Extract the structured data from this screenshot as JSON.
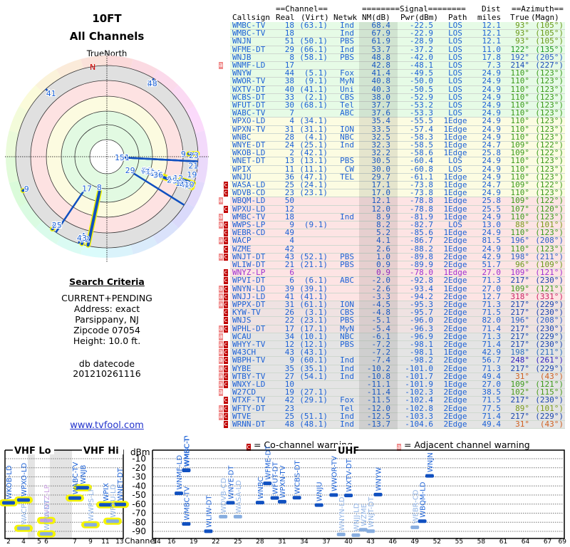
{
  "report": {
    "title": "10FT",
    "subtitle": "All Channels",
    "north_label": "TrueNorth",
    "n_marker": "N"
  },
  "criteria": {
    "heading": "Search Criteria",
    "lines": [
      "CURRENT+PENDING",
      "Address: exact",
      "Parsippany, NJ",
      "Zipcode 07054",
      "Height: 10.0 ft."
    ],
    "datecode_label": "db datecode",
    "datecode": "201210261116",
    "link": "www.tvfool.com"
  },
  "table": {
    "group_headers": {
      "channel": "==Channel==",
      "signal": "========Signal========",
      "dist": "Dist",
      "azimuth": "==Azimuth=="
    },
    "columns": [
      "Callsign",
      "Real",
      "(Virt)",
      "Netwk",
      "NM(dB)",
      "Pwr(dBm)",
      "Path",
      "miles",
      "True",
      "(Magn)"
    ],
    "rows": [
      {
        "flags": "",
        "call": "WMBC-TV",
        "real": "18",
        "virt": "(63.1)",
        "net": "Ind",
        "nm": "68.4",
        "pwr": "-22.5",
        "path": "LOS",
        "dist": "12.1",
        "true": "93°",
        "magn": "(105°)",
        "az_color": "#6a9a1a",
        "bg": "green"
      },
      {
        "flags": "",
        "call": "WMBC-TV",
        "real": "18",
        "virt": "",
        "net": "Ind",
        "nm": "67.9",
        "pwr": "-22.9",
        "path": "LOS",
        "dist": "12.1",
        "true": "93°",
        "magn": "(105°)",
        "az_color": "#6a9a1a",
        "bg": "green"
      },
      {
        "flags": "",
        "call": "WNJN",
        "real": "51",
        "virt": "(50.1)",
        "net": "PBS",
        "nm": "61.9",
        "pwr": "-28.9",
        "path": "LOS",
        "dist": "12.1",
        "true": "93°",
        "magn": "(105°)",
        "az_color": "#6a9a1a",
        "bg": "green"
      },
      {
        "flags": "",
        "call": "WFME-DT",
        "real": "29",
        "virt": "(66.1)",
        "net": "Ind",
        "nm": "53.7",
        "pwr": "-37.2",
        "path": "LOS",
        "dist": "11.0",
        "true": "122°",
        "magn": "(135°)",
        "az_color": "#229a22",
        "bg": "green"
      },
      {
        "flags": "",
        "call": "WNJB",
        "real": "8",
        "virt": "(58.1)",
        "net": "PBS",
        "nm": "48.8",
        "pwr": "-42.0",
        "path": "LOS",
        "dist": "17.8",
        "true": "192°",
        "magn": "(205°)",
        "az_color": "#2a5fc8",
        "bg": "green"
      },
      {
        "flags": "a",
        "call": "WNMF-LD",
        "real": "17",
        "virt": "",
        "net": "",
        "nm": "42.8",
        "pwr": "-48.1",
        "path": "LOS",
        "dist": "7.3",
        "true": "214°",
        "magn": "(227°)",
        "az_color": "#1a4cb8",
        "bg": "green"
      },
      {
        "flags": "",
        "call": "WNYW",
        "real": "44",
        "virt": "(5.1)",
        "net": "Fox",
        "nm": "41.4",
        "pwr": "-49.5",
        "path": "LOS",
        "dist": "24.9",
        "true": "110°",
        "magn": "(123°)",
        "az_color": "#3a9a1a",
        "bg": "green"
      },
      {
        "flags": "",
        "call": "WWOR-TV",
        "real": "38",
        "virt": "(9.1)",
        "net": "MyN",
        "nm": "40.8",
        "pwr": "-50.0",
        "path": "LOS",
        "dist": "24.9",
        "true": "110°",
        "magn": "(123°)",
        "az_color": "#3a9a1a",
        "bg": "green"
      },
      {
        "flags": "",
        "call": "WXTV-DT",
        "real": "40",
        "virt": "(41.1)",
        "net": "Uni",
        "nm": "40.3",
        "pwr": "-50.5",
        "path": "LOS",
        "dist": "24.9",
        "true": "110°",
        "magn": "(123°)",
        "az_color": "#3a9a1a",
        "bg": "green"
      },
      {
        "flags": "",
        "call": "WCBS-DT",
        "real": "33",
        "virt": "(2.1)",
        "net": "CBS",
        "nm": "38.0",
        "pwr": "-52.9",
        "path": "LOS",
        "dist": "24.9",
        "true": "110°",
        "magn": "(123°)",
        "az_color": "#3a9a1a",
        "bg": "green"
      },
      {
        "flags": "",
        "call": "WFUT-DT",
        "real": "30",
        "virt": "(68.1)",
        "net": "Tel",
        "nm": "37.7",
        "pwr": "-53.2",
        "path": "LOS",
        "dist": "24.9",
        "true": "110°",
        "magn": "(123°)",
        "az_color": "#3a9a1a",
        "bg": "green"
      },
      {
        "flags": "",
        "call": "WABC-TV",
        "real": "7",
        "virt": "",
        "net": "ABC",
        "nm": "37.6",
        "pwr": "-53.3",
        "path": "LOS",
        "dist": "24.9",
        "true": "110°",
        "magn": "(123°)",
        "az_color": "#3a9a1a",
        "bg": "green"
      },
      {
        "flags": "",
        "call": "WPXO-LD",
        "real": "4",
        "virt": "(34.1)",
        "net": "",
        "nm": "35.4",
        "pwr": "-55.5",
        "path": "1Edge",
        "dist": "24.9",
        "true": "110°",
        "magn": "(123°)",
        "az_color": "#3a9a1a",
        "bg": "yellow"
      },
      {
        "flags": "",
        "call": "WPXN-TV",
        "real": "31",
        "virt": "(31.1)",
        "net": "ION",
        "nm": "33.5",
        "pwr": "-57.4",
        "path": "1Edge",
        "dist": "24.9",
        "true": "110°",
        "magn": "(123°)",
        "az_color": "#3a9a1a",
        "bg": "yellow"
      },
      {
        "flags": "",
        "call": "WNBC",
        "real": "28",
        "virt": "(4.1)",
        "net": "NBC",
        "nm": "32.5",
        "pwr": "-58.3",
        "path": "1Edge",
        "dist": "24.9",
        "true": "110°",
        "magn": "(123°)",
        "az_color": "#3a9a1a",
        "bg": "yellow"
      },
      {
        "flags": "",
        "call": "WNYE-DT",
        "real": "24",
        "virt": "(25.1)",
        "net": "Ind",
        "nm": "32.3",
        "pwr": "-58.5",
        "path": "1Edge",
        "dist": "24.7",
        "true": "109°",
        "magn": "(122°)",
        "az_color": "#3a9a1a",
        "bg": "yellow"
      },
      {
        "flags": "",
        "call": "WKOB-LD",
        "real": "2",
        "virt": "(42.1)",
        "net": "",
        "nm": "32.2",
        "pwr": "-58.6",
        "path": "1Edge",
        "dist": "25.8",
        "true": "109°",
        "magn": "(122°)",
        "az_color": "#3a9a1a",
        "bg": "yellow"
      },
      {
        "flags": "",
        "call": "WNET-DT",
        "real": "13",
        "virt": "(13.1)",
        "net": "PBS",
        "nm": "30.5",
        "pwr": "-60.4",
        "path": "LOS",
        "dist": "24.9",
        "true": "110°",
        "magn": "(123°)",
        "az_color": "#3a9a1a",
        "bg": "yellow"
      },
      {
        "flags": "",
        "call": "WPIX",
        "real": "11",
        "virt": "(11.1)",
        "net": "CW",
        "nm": "30.0",
        "pwr": "-60.8",
        "path": "LOS",
        "dist": "24.9",
        "true": "110°",
        "magn": "(123°)",
        "az_color": "#3a9a1a",
        "bg": "yellow"
      },
      {
        "flags": "",
        "call": "WNJU",
        "real": "36",
        "virt": "(47.1)",
        "net": "TEL",
        "nm": "29.7",
        "pwr": "-61.1",
        "path": "1Edge",
        "dist": "24.9",
        "true": "110°",
        "magn": "(123°)",
        "az_color": "#3a9a1a",
        "bg": "yellow"
      },
      {
        "flags": "c",
        "call": "WASA-LD",
        "real": "25",
        "virt": "(24.1)",
        "net": "",
        "nm": "17.1",
        "pwr": "-73.8",
        "path": "1Edge",
        "dist": "24.7",
        "true": "109°",
        "magn": "(122°)",
        "az_color": "#3a9a1a",
        "bg": "yellow"
      },
      {
        "flags": "c",
        "call": "WDVB-CD",
        "real": "23",
        "virt": "(23.1)",
        "net": "",
        "nm": "17.0",
        "pwr": "-73.8",
        "path": "1Edge",
        "dist": "24.9",
        "true": "110°",
        "magn": "(123°)",
        "az_color": "#3a9a1a",
        "bg": "yellow"
      },
      {
        "flags": "a",
        "call": "WBQM-LD",
        "real": "50",
        "virt": "",
        "net": "",
        "nm": "12.1",
        "pwr": "-78.8",
        "path": "1Edge",
        "dist": "25.8",
        "true": "109°",
        "magn": "(122°)",
        "az_color": "#3a9a1a",
        "bg": "pink"
      },
      {
        "flags": "c",
        "call": "WPXU-LD",
        "real": "12",
        "virt": "",
        "net": "",
        "nm": "12.0",
        "pwr": "-78.8",
        "path": "1Edge",
        "dist": "25.5",
        "true": "107°",
        "magn": "(120°)",
        "az_color": "#3a9a1a",
        "bg": "pink"
      },
      {
        "flags": "a",
        "call": "WMBC-TV",
        "real": "18",
        "virt": "",
        "net": "Ind",
        "nm": "8.9",
        "pwr": "-81.9",
        "path": "1Edge",
        "dist": "24.9",
        "true": "110°",
        "magn": "(123°)",
        "az_color": "#3a9a1a",
        "bg": "pink"
      },
      {
        "flags": "ac",
        "call": "WWPS-LP",
        "real": "9",
        "virt": "(9.1)",
        "net": "",
        "nm": "8.2",
        "pwr": "-82.7",
        "path": "LOS",
        "dist": "13.0",
        "true": "88°",
        "magn": "(101°)",
        "az_color": "#7a9a1a",
        "bg": "pink"
      },
      {
        "flags": "c",
        "call": "WEBR-CD",
        "real": "49",
        "virt": "",
        "net": "",
        "nm": "5.2",
        "pwr": "-85.6",
        "path": "1Edge",
        "dist": "24.9",
        "true": "110°",
        "magn": "(123°)",
        "az_color": "#3a9a1a",
        "bg": "pink"
      },
      {
        "flags": "ac",
        "call": "WACP",
        "real": "4",
        "virt": "",
        "net": "",
        "nm": "4.1",
        "pwr": "-86.7",
        "path": "2Edge",
        "dist": "81.5",
        "true": "196°",
        "magn": "(208°)",
        "az_color": "#2a5fc8",
        "bg": "pink"
      },
      {
        "flags": "c",
        "call": "WZME",
        "real": "42",
        "virt": "",
        "net": "",
        "nm": "2.6",
        "pwr": "-88.2",
        "path": "1Edge",
        "dist": "24.9",
        "true": "110°",
        "magn": "(123°)",
        "az_color": "#3a9a1a",
        "bg": "pink"
      },
      {
        "flags": "ac",
        "call": "WNJT-DT",
        "real": "43",
        "virt": "(52.1)",
        "net": "PBS",
        "nm": "1.0",
        "pwr": "-89.8",
        "path": "2Edge",
        "dist": "42.9",
        "true": "198°",
        "magn": "(211°)",
        "az_color": "#2a5fc8",
        "bg": "pink"
      },
      {
        "flags": "",
        "call": "WLIW-DT",
        "real": "21",
        "virt": "(21.1)",
        "net": "PBS",
        "nm": "0.9",
        "pwr": "-89.9",
        "path": "2Edge",
        "dist": "51.7",
        "true": "96°",
        "magn": "(109°)",
        "az_color": "#6a9a1a",
        "bg": "pink"
      },
      {
        "flags": "c",
        "call": "WNYZ-LP",
        "real": "6",
        "virt": "",
        "net": "",
        "nm": "0.9",
        "pwr": "-78.0",
        "path": "1Edge",
        "dist": "27.0",
        "true": "109°",
        "magn": "(121°)",
        "az_color": "#3a9a1a",
        "bg": "pink",
        "text_color": "#a030d0"
      },
      {
        "flags": "c",
        "call": "WPVI-DT",
        "real": "6",
        "virt": "(6.1)",
        "net": "ABC",
        "nm": "-2.0",
        "pwr": "-92.8",
        "path": "2Edge",
        "dist": "71.3",
        "true": "217°",
        "magn": "(230°)",
        "az_color": "#1a45b0",
        "bg": "pink"
      },
      {
        "flags": "ac",
        "call": "WNYN-LD",
        "real": "39",
        "virt": "(39.1)",
        "net": "",
        "nm": "-2.6",
        "pwr": "-93.4",
        "path": "1Edge",
        "dist": "27.0",
        "true": "109°",
        "magn": "(121°)",
        "az_color": "#3a9a1a",
        "bg": "pink"
      },
      {
        "flags": "ac",
        "call": "WNJJ-LD",
        "real": "41",
        "virt": "(41.1)",
        "net": "",
        "nm": "-3.3",
        "pwr": "-94.2",
        "path": "2Edge",
        "dist": "12.7",
        "true": "318°",
        "magn": "(331°)",
        "az_color": "#cc2266",
        "bg": "pink"
      },
      {
        "flags": "ac",
        "call": "WPPX-DT",
        "real": "31",
        "virt": "(61.1)",
        "net": "ION",
        "nm": "-4.5",
        "pwr": "-95.3",
        "path": "2Edge",
        "dist": "71.3",
        "true": "217°",
        "magn": "(229°)",
        "az_color": "#1a45b0",
        "bg": "pinkgray"
      },
      {
        "flags": "c",
        "call": "KYW-TV",
        "real": "26",
        "virt": "(3.1)",
        "net": "CBS",
        "nm": "-4.8",
        "pwr": "-95.7",
        "path": "2Edge",
        "dist": "71.5",
        "true": "217°",
        "magn": "(230°)",
        "az_color": "#1a45b0",
        "bg": "pinkgray"
      },
      {
        "flags": "c",
        "call": "WNJS",
        "real": "22",
        "virt": "(23.1)",
        "net": "PBS",
        "nm": "-5.1",
        "pwr": "-96.0",
        "path": "2Edge",
        "dist": "82.0",
        "true": "196°",
        "magn": "(208°)",
        "az_color": "#2a5fc8",
        "bg": "pinkgray"
      },
      {
        "flags": "ac",
        "call": "WPHL-DT",
        "real": "17",
        "virt": "(17.1)",
        "net": "MyN",
        "nm": "-5.4",
        "pwr": "-96.3",
        "path": "2Edge",
        "dist": "71.4",
        "true": "217°",
        "magn": "(230°)",
        "az_color": "#1a45b0",
        "bg": "pinkgray"
      },
      {
        "flags": "a",
        "call": "WCAU",
        "real": "34",
        "virt": "(10.1)",
        "net": "NBC",
        "nm": "-6.1",
        "pwr": "-96.9",
        "path": "2Edge",
        "dist": "71.3",
        "true": "217°",
        "magn": "(229°)",
        "az_color": "#1a45b0",
        "bg": "gray"
      },
      {
        "flags": "ac",
        "call": "WHYY-TV",
        "real": "12",
        "virt": "(12.1)",
        "net": "PBS",
        "nm": "-7.2",
        "pwr": "-98.1",
        "path": "2Edge",
        "dist": "71.4",
        "true": "217°",
        "magn": "(230°)",
        "az_color": "#1a45b0",
        "bg": "gray"
      },
      {
        "flags": "ac",
        "call": "W43CH",
        "real": "43",
        "virt": "(43.1)",
        "net": "",
        "nm": "-7.2",
        "pwr": "-98.1",
        "path": "1Edge",
        "dist": "42.9",
        "true": "198°",
        "magn": "(211°)",
        "az_color": "#2a6fc0",
        "bg": "gray"
      },
      {
        "flags": "ac",
        "call": "WBPH-TV",
        "real": "9",
        "virt": "(60.1)",
        "net": "Ind",
        "nm": "-7.4",
        "pwr": "-98.2",
        "path": "2Edge",
        "dist": "56.7",
        "true": "248°",
        "magn": "(261°)",
        "az_color": "#3020c0",
        "bg": "gray"
      },
      {
        "flags": "ac",
        "call": "WYBE",
        "real": "35",
        "virt": "(35.1)",
        "net": "Ind",
        "nm": "-10.2",
        "pwr": "-101.0",
        "path": "2Edge",
        "dist": "71.3",
        "true": "217°",
        "magn": "(229°)",
        "az_color": "#1a45b0",
        "bg": "gray"
      },
      {
        "flags": "ac",
        "call": "WTBY-TV",
        "real": "27",
        "virt": "(54.1)",
        "net": "Ind",
        "nm": "-10.8",
        "pwr": "-101.7",
        "path": "2Edge",
        "dist": "49.4",
        "true": "31°",
        "magn": "(43°)",
        "az_color": "#d06020",
        "bg": "gray"
      },
      {
        "flags": "ac",
        "call": "WNXY-LD",
        "real": "10",
        "virt": "",
        "net": "",
        "nm": "-11.1",
        "pwr": "-101.9",
        "path": "1Edge",
        "dist": "27.0",
        "true": "109°",
        "magn": "(121°)",
        "az_color": "#3a9a1a",
        "bg": "gray"
      },
      {
        "flags": "a",
        "call": "W27CD",
        "real": "19",
        "virt": "(27.1)",
        "net": "",
        "nm": "-11.4",
        "pwr": "-102.3",
        "path": "2Edge",
        "dist": "38.5",
        "true": "102°",
        "magn": "(115°)",
        "az_color": "#4a9a1a",
        "bg": "gray"
      },
      {
        "flags": "c",
        "call": "WTXF-TV",
        "real": "42",
        "virt": "(29.1)",
        "net": "Fox",
        "nm": "-11.5",
        "pwr": "-102.4",
        "path": "2Edge",
        "dist": "71.5",
        "true": "217°",
        "magn": "(230°)",
        "az_color": "#1a45b0",
        "bg": "gray"
      },
      {
        "flags": "ac",
        "call": "WFTY-DT",
        "real": "23",
        "virt": "",
        "net": "Tel",
        "nm": "-12.0",
        "pwr": "-102.8",
        "path": "2Edge",
        "dist": "77.5",
        "true": "89°",
        "magn": "(101°)",
        "az_color": "#7a9a1a",
        "bg": "gray"
      },
      {
        "flags": "ac",
        "call": "WTVE",
        "real": "25",
        "virt": "(51.1)",
        "net": "Ind",
        "nm": "-12.5",
        "pwr": "-103.3",
        "path": "2Edge",
        "dist": "71.4",
        "true": "217°",
        "magn": "(229°)",
        "az_color": "#1a45b0",
        "bg": "gray"
      },
      {
        "flags": "c",
        "call": "WRNN-DT",
        "real": "48",
        "virt": "(48.1)",
        "net": "Ind",
        "nm": "-13.7",
        "pwr": "-104.6",
        "path": "2Edge",
        "dist": "49.4",
        "true": "31°",
        "magn": "(43°)",
        "az_color": "#d06020",
        "bg": "gray"
      }
    ]
  },
  "legend": {
    "co_flag": "c",
    "co_label": "= Co-channel warning",
    "adj_flag": "a",
    "adj_label": "= Adjacent channel warning"
  },
  "spectrum": {
    "vhf_lo": "VHF Lo",
    "vhf_hi": "VHF Hi",
    "uhf": "UHF",
    "unit": "dBm",
    "channel_label": "Channel",
    "dbm_ticks": [
      "-10",
      "-20",
      "-30",
      "-40",
      "-50",
      "-60",
      "-70",
      "-80",
      "-90"
    ],
    "vhf_ticks": [
      "2",
      "4",
      "5",
      "6",
      "7",
      "9",
      "11",
      "13"
    ],
    "uhf_ticks": [
      "14",
      "16",
      "19",
      "22",
      "25",
      "28",
      "31",
      "34",
      "37",
      "40",
      "43",
      "46",
      "49",
      "52",
      "55",
      "58",
      "61",
      "64",
      "67",
      "69"
    ]
  },
  "colors": {
    "text_blue": "#1d62d6",
    "co_channel": "#c00000",
    "adjacent": "#f08a8a",
    "bar": "#1050c0",
    "bar_faded": "#88aee0",
    "vhf_halo": "#f4f400",
    "row_bg": {
      "green": "#e6fbe6",
      "yellow": "#fcfce2",
      "pink": "#fde4e4",
      "pinkgray": "#efe2e2",
      "gray": "#e4e4e4"
    }
  }
}
